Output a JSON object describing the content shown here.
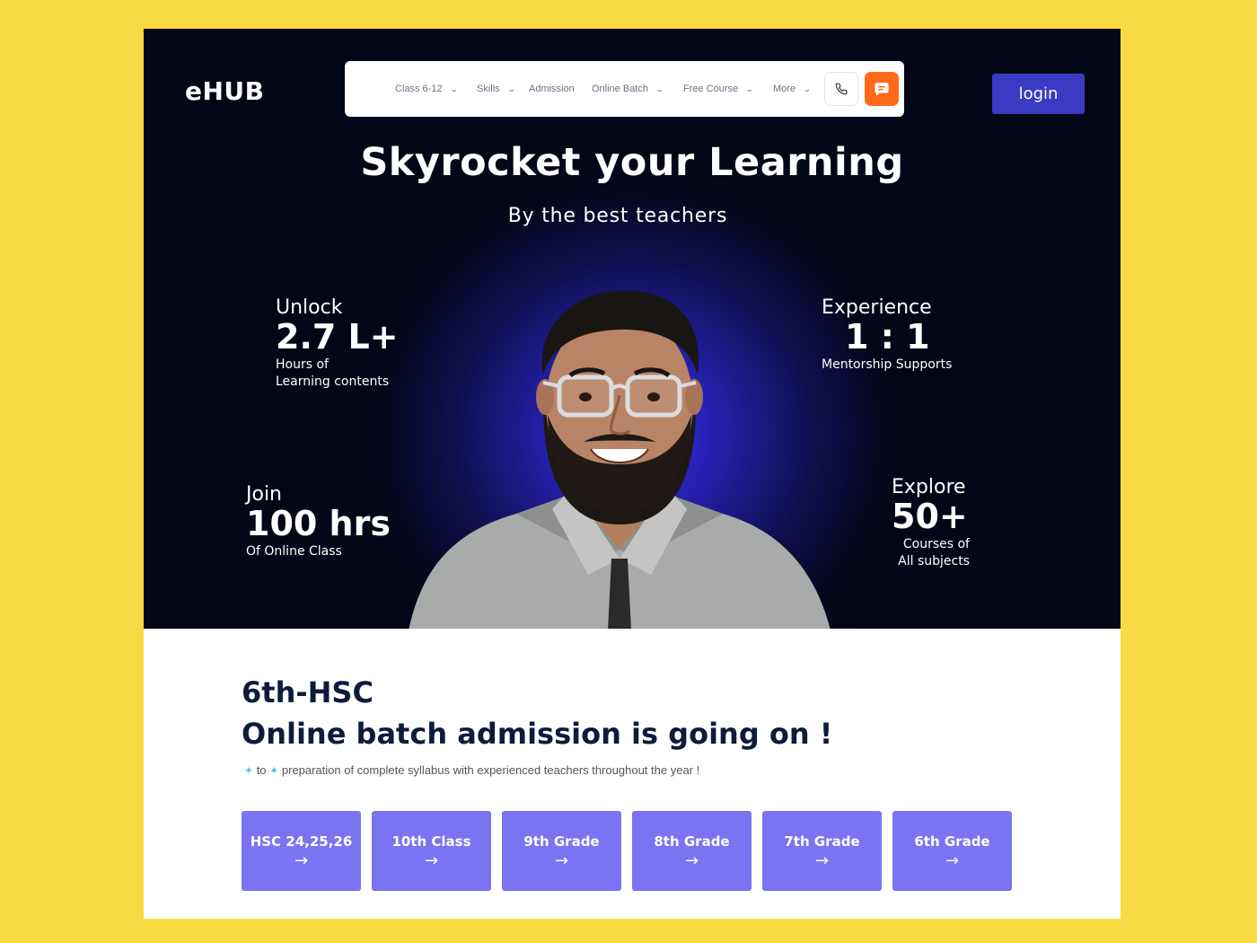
{
  "brand": {
    "logo": "eHUB"
  },
  "nav": {
    "items": [
      {
        "label": "Class 6-12",
        "has_dropdown": true
      },
      {
        "label": "Skills",
        "has_dropdown": true
      },
      {
        "label": "Admission",
        "has_dropdown": false
      },
      {
        "label": "Online Batch",
        "has_dropdown": true
      },
      {
        "label": "Free Course",
        "has_dropdown": true
      },
      {
        "label": "More",
        "has_dropdown": true
      }
    ],
    "chevron": "⌄",
    "phone_icon": "phone-icon",
    "chat_icon": "chat-icon",
    "chat_color": "#FF6A1A"
  },
  "header": {
    "login_label": "login",
    "login_color": "#3A3BC4"
  },
  "hero": {
    "title": "Skyrocket your Learning",
    "subtitle": "By the best teachers",
    "stats": [
      {
        "label": "Unlock",
        "value": "2.7 L+",
        "desc1": "Hours of",
        "desc2": "Learning contents"
      },
      {
        "label": "Experience",
        "value": "1 : 1",
        "desc1": "Mentorship Supports",
        "desc2": ""
      },
      {
        "label": "Join",
        "value": "100 hrs",
        "desc1": "Of Online Class",
        "desc2": ""
      },
      {
        "label": "Explore",
        "value": "50+",
        "desc1": "Courses of",
        "desc2": "All  subjects"
      }
    ]
  },
  "admission": {
    "title1": "6th-HSC",
    "title2": "Online batch admission is going on !",
    "tagline_to": "to",
    "tagline": "preparation of complete syllabus with experienced teachers throughout the year !",
    "grades": [
      {
        "label": "HSC 24,25,26"
      },
      {
        "label": "10th Class"
      },
      {
        "label": "9th Grade"
      },
      {
        "label": "8th Grade"
      },
      {
        "label": "7th Grade"
      },
      {
        "label": "6th Grade"
      }
    ],
    "arrow": "→",
    "button_color": "#7A74F2"
  }
}
